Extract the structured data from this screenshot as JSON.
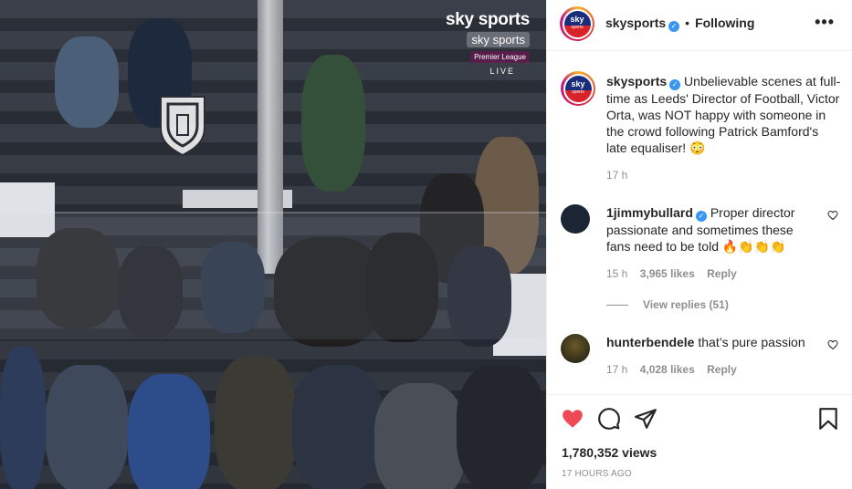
{
  "video": {
    "broadcaster": "sky sports",
    "channel": "sky sports",
    "league": "Premier League",
    "status": "LIVE"
  },
  "header": {
    "username": "skysports",
    "separator": "•",
    "follow_status": "Following",
    "more": "•••"
  },
  "caption": {
    "username": "skysports",
    "text": "Unbelievable scenes at full-time as Leeds' Director of Football, Victor Orta, was NOT happy with someone in the crowd following Patrick Bamford's late equaliser! 😳",
    "time": "17 h"
  },
  "comments": [
    {
      "username": "1jimmybullard",
      "verified": true,
      "text": "Proper director passionate and sometimes these fans need to be told 🔥👏👏👏",
      "time": "15 h",
      "likes": "3,965 likes",
      "reply": "Reply"
    },
    {
      "username": "hunterbendele",
      "verified": false,
      "text": "that’s pure passion",
      "time": "17 h",
      "likes": "4,028 likes",
      "reply": "Reply"
    }
  ],
  "view_replies": "View replies (51)",
  "stats": {
    "views": "1,780,352 views",
    "posted": "17 HOURS AGO"
  },
  "icons": {
    "like": "heart-icon",
    "comment": "comment-icon",
    "share": "share-icon",
    "save": "bookmark-icon",
    "verified": "verified-badge-icon"
  },
  "colors": {
    "like_active": "#ed4956",
    "verified": "#3897f0",
    "muted_text": "#8e8e8e"
  }
}
